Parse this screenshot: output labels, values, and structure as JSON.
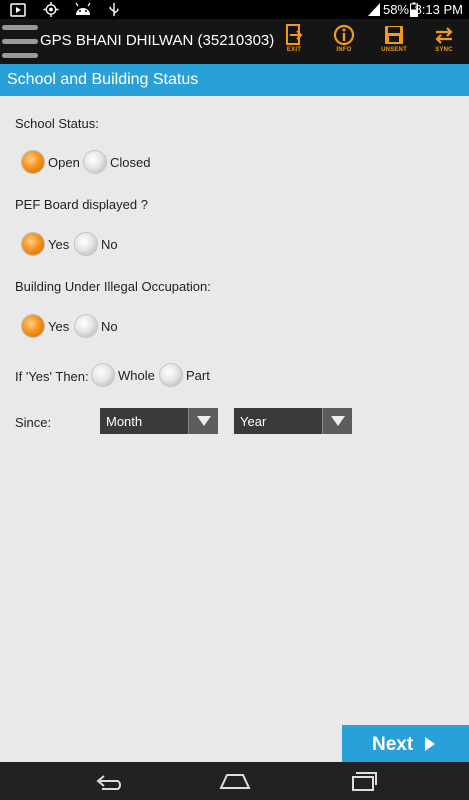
{
  "status_bar": {
    "battery": "58%",
    "time": "8:13 PM",
    "icons": [
      "youtube-icon",
      "gps-icon",
      "android-icon",
      "usb-icon",
      "signal-icon",
      "battery-icon"
    ]
  },
  "action_bar": {
    "title": "GPS BHANI DHILWAN (35210303)",
    "buttons": [
      {
        "label": "EXIT",
        "icon": "exit-icon"
      },
      {
        "label": "INFO",
        "icon": "info-icon"
      },
      {
        "label": "UNSENT",
        "icon": "unsent-icon"
      },
      {
        "label": "SYNC",
        "icon": "sync-icon"
      }
    ],
    "accent": "#f39a1d"
  },
  "section": {
    "title": "School and Building Status",
    "color": "#2aa0d8"
  },
  "form": {
    "school_status": {
      "label": "School Status:",
      "options": [
        "Open",
        "Closed"
      ],
      "selected": "Open"
    },
    "pef_board": {
      "label": "PEF Board displayed ?",
      "options": [
        "Yes",
        "No"
      ],
      "selected": "Yes"
    },
    "illegal_occupation": {
      "label": "Building Under Illegal Occupation:",
      "options": [
        "Yes",
        "No"
      ],
      "selected": "Yes"
    },
    "occupation_extent": {
      "label": "If 'Yes' Then:",
      "options": [
        "Whole",
        "Part"
      ],
      "selected": null
    },
    "since": {
      "label": "Since:",
      "month_value": "Month",
      "year_value": "Year"
    }
  },
  "next_button": {
    "label": "Next"
  },
  "navigation": {
    "buttons": [
      "back-icon",
      "home-icon",
      "recent-apps-icon"
    ]
  }
}
